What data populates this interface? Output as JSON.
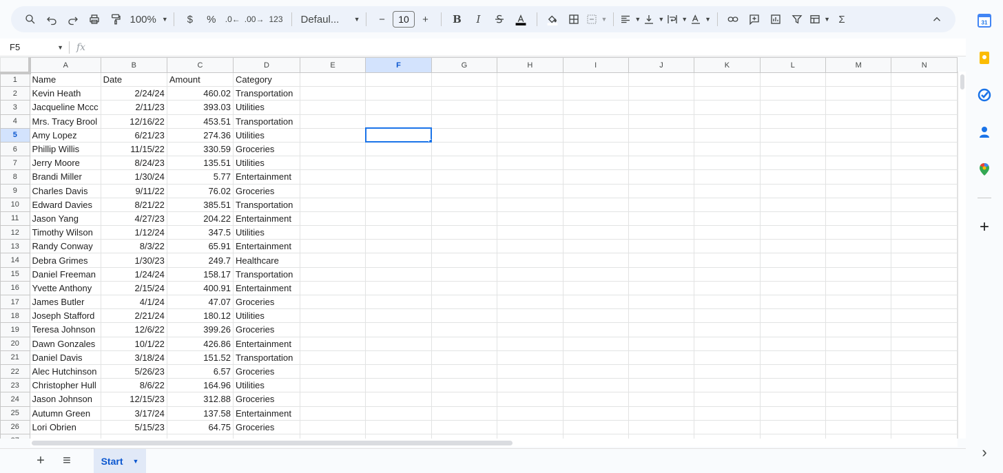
{
  "toolbar": {
    "zoom": "100%",
    "currency": "$",
    "percent": "%",
    "dec_decrease": ".0",
    "dec_increase": ".00",
    "number_format": "123",
    "font_family": "Defaul...",
    "font_size": "10",
    "minus": "−",
    "plus": "+",
    "bold": "B",
    "italic": "I",
    "sigma": "Σ"
  },
  "formula_bar": {
    "name_box": "F5",
    "fx_label": "fx",
    "value": ""
  },
  "grid": {
    "columns": [
      "A",
      "B",
      "C",
      "D",
      "E",
      "F",
      "G",
      "H",
      "I",
      "J",
      "K",
      "L",
      "M",
      "N"
    ],
    "selected_column": "F",
    "selected_row": 5,
    "rows": [
      [
        "Name",
        "Date",
        "Amount",
        "Category"
      ],
      [
        "Kevin Heath",
        "2/24/24",
        "460.02",
        "Transportation"
      ],
      [
        "Jacqueline Mccc",
        "2/11/23",
        "393.03",
        "Utilities"
      ],
      [
        "Mrs. Tracy Brool",
        "12/16/22",
        "453.51",
        "Transportation"
      ],
      [
        "Amy Lopez",
        "6/21/23",
        "274.36",
        "Utilities"
      ],
      [
        "Phillip Willis",
        "11/15/22",
        "330.59",
        "Groceries"
      ],
      [
        "Jerry Moore",
        "8/24/23",
        "135.51",
        "Utilities"
      ],
      [
        "Brandi Miller",
        "1/30/24",
        "5.77",
        "Entertainment"
      ],
      [
        "Charles Davis",
        "9/11/22",
        "76.02",
        "Groceries"
      ],
      [
        "Edward Davies",
        "8/21/22",
        "385.51",
        "Transportation"
      ],
      [
        "Jason Yang",
        "4/27/23",
        "204.22",
        "Entertainment"
      ],
      [
        "Timothy Wilson",
        "1/12/24",
        "347.5",
        "Utilities"
      ],
      [
        "Randy Conway",
        "8/3/22",
        "65.91",
        "Entertainment"
      ],
      [
        "Debra Grimes",
        "1/30/23",
        "249.7",
        "Healthcare"
      ],
      [
        "Daniel Freeman",
        "1/24/24",
        "158.17",
        "Transportation"
      ],
      [
        "Yvette Anthony",
        "2/15/24",
        "400.91",
        "Entertainment"
      ],
      [
        "James Butler",
        "4/1/24",
        "47.07",
        "Groceries"
      ],
      [
        "Joseph Stafford",
        "2/21/24",
        "180.12",
        "Utilities"
      ],
      [
        "Teresa Johnson",
        "12/6/22",
        "399.26",
        "Groceries"
      ],
      [
        "Dawn Gonzales",
        "10/1/22",
        "426.86",
        "Entertainment"
      ],
      [
        "Daniel Davis",
        "3/18/24",
        "151.52",
        "Transportation"
      ],
      [
        "Alec Hutchinson",
        "5/26/23",
        "6.57",
        "Groceries"
      ],
      [
        "Christopher Hull",
        "8/6/22",
        "164.96",
        "Utilities"
      ],
      [
        "Jason Johnson",
        "12/15/23",
        "312.88",
        "Groceries"
      ],
      [
        "Autumn Green",
        "3/17/24",
        "137.58",
        "Entertainment"
      ],
      [
        "Lori Obrien",
        "5/15/23",
        "64.75",
        "Groceries"
      ]
    ]
  },
  "sheets": {
    "tabs": [
      {
        "label": "Start",
        "active": true
      }
    ],
    "add_sheet_label": "+",
    "all_sheets_label": "≡"
  },
  "side_panel": {
    "calendar_day": "31",
    "add_label": "+",
    "expand_label": "›"
  }
}
